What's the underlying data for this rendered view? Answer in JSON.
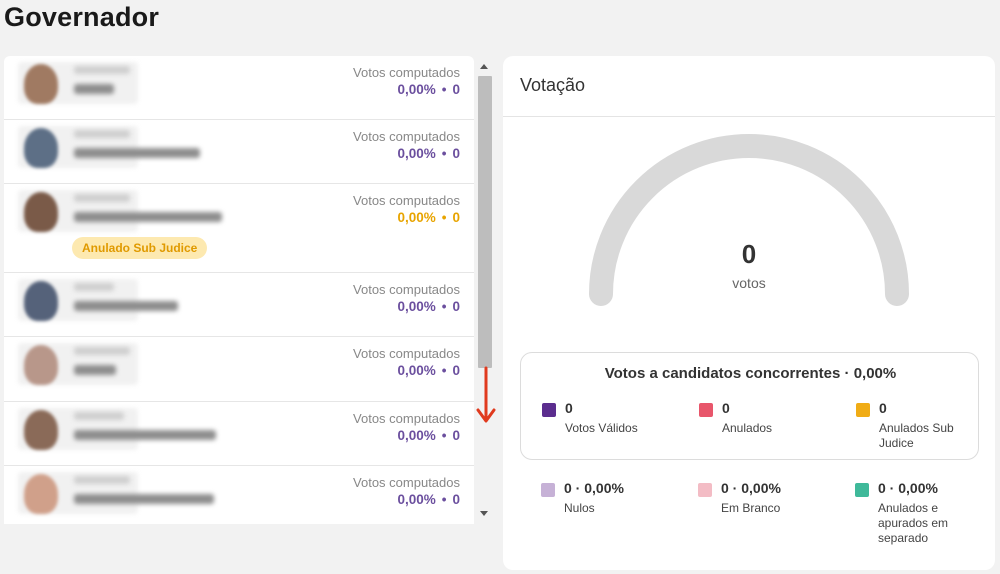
{
  "page": {
    "title": "Governador"
  },
  "candidates": [
    {
      "votes_label": "Votos computados",
      "percent": "0,00%",
      "count": "0",
      "status": ""
    },
    {
      "votes_label": "Votos computados",
      "percent": "0,00%",
      "count": "0",
      "status": ""
    },
    {
      "votes_label": "Votos computados",
      "percent": "0,00%",
      "count": "0",
      "status": "Anulado Sub Judice"
    },
    {
      "votes_label": "Votos computados",
      "percent": "0,00%",
      "count": "0",
      "status": ""
    },
    {
      "votes_label": "Votos computados",
      "percent": "0,00%",
      "count": "0",
      "status": ""
    },
    {
      "votes_label": "Votos computados",
      "percent": "0,00%",
      "count": "0",
      "status": ""
    },
    {
      "votes_label": "Votos computados",
      "percent": "0,00%",
      "count": "0",
      "status": ""
    }
  ],
  "separator_dot": "•",
  "votacao": {
    "title": "Votação",
    "total": "0",
    "total_label": "votos",
    "concorrentes_title": "Votos a candidatos concorrentes · 0,00%",
    "stats_top": [
      {
        "value": "0",
        "label": "Votos Válidos",
        "color": "#5b2d8e"
      },
      {
        "value": "0",
        "label": "Anulados",
        "color": "#e8566b"
      },
      {
        "value": "0",
        "label": "Anulados Sub Judice",
        "color": "#f0ac16"
      }
    ],
    "stats_bottom": [
      {
        "value": "0 · 0,00%",
        "label": "Nulos",
        "color": "#c6b1d6"
      },
      {
        "value": "0 · 0,00%",
        "label": "Em Branco",
        "color": "#f3bcc5"
      },
      {
        "value": "0 · 0,00%",
        "label": "Anulados e apurados em separado",
        "color": "#3fb99a"
      }
    ]
  },
  "colors": {
    "accent_purple": "#6b4f9e",
    "warning_amber": "#e8a400",
    "badge_bg": "#fde9b0",
    "gauge_track": "#d9d9d9",
    "arrow_red": "#e03a1e"
  }
}
